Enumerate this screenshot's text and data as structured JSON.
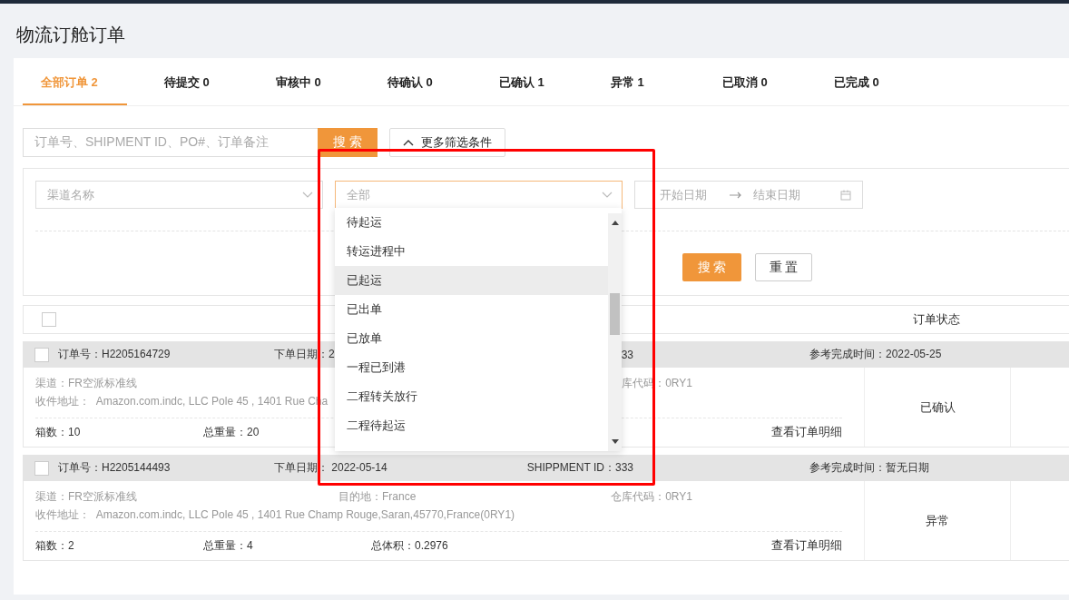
{
  "page_title": "物流订舱订单",
  "tabs": [
    {
      "label": "全部订单 2",
      "selected": true
    },
    {
      "label": "待提交 0",
      "selected": false
    },
    {
      "label": "审核中 0",
      "selected": false
    },
    {
      "label": "待确认 0",
      "selected": false
    },
    {
      "label": "已确认 1",
      "selected": false
    },
    {
      "label": "异常 1",
      "selected": false
    },
    {
      "label": "已取消 0",
      "selected": false
    },
    {
      "label": "已完成 0",
      "selected": false
    }
  ],
  "search": {
    "placeholder": "订单号、SHIPMENT ID、PO#、订单备注",
    "button": "搜 索",
    "more_filters": "更多筛选条件"
  },
  "filters": {
    "channel_placeholder": "渠道名称",
    "status_placeholder": "全部",
    "start_placeholder": "开始日期",
    "end_placeholder": "结束日期",
    "search_button": "搜 索",
    "reset_button": "重 置"
  },
  "status_dropdown": {
    "open": true,
    "items": [
      {
        "label": "待起运",
        "highlighted": false
      },
      {
        "label": "转运进程中",
        "highlighted": false
      },
      {
        "label": "已起运",
        "highlighted": true
      },
      {
        "label": "已出单",
        "highlighted": false
      },
      {
        "label": "已放单",
        "highlighted": false
      },
      {
        "label": "一程已到港",
        "highlighted": false
      },
      {
        "label": "二程转关放行",
        "highlighted": false
      },
      {
        "label": "二程待起运",
        "highlighted": false
      }
    ]
  },
  "table": {
    "select_all_checked": false,
    "status_column": "订单状态"
  },
  "orders": [
    {
      "checked": false,
      "order_no": "订单号：H2205164729",
      "order_date": "下单日期：2",
      "shipment_id": "33",
      "ref_time": "参考完成时间：2022-05-25",
      "channel": "渠道：FR空派标准线",
      "warehouse": "库代码：0RY1",
      "address": "收件地址：  Amazon.com.indc, LLC Pole 45 , 1401 Rue Cha",
      "boxes": "箱数：10",
      "weight": "总重量：20",
      "detail_link": "查看订单明细",
      "status": "已确认"
    },
    {
      "checked": false,
      "order_no": "订单号：H2205144493",
      "order_date": "下单日期：  2022-05-14",
      "shipment_id": "SHIPPMENT ID：333",
      "ref_time": "参考完成时间：暂无日期",
      "channel": "渠道：FR空派标准线",
      "destination": "目的地：France",
      "warehouse": "仓库代码：0RY1",
      "address": "收件地址：  Amazon.com.indc, LLC Pole 45 , 1401 Rue Champ Rouge,Saran,45770,France(0RY1)",
      "boxes": "箱数：2",
      "weight": "总重量：4",
      "volume": "总体积：0.2976",
      "detail_link": "查看订单明细",
      "status": "异常"
    }
  ]
}
